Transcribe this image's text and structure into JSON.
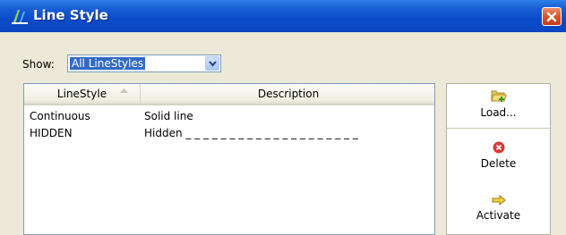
{
  "window": {
    "title": "Line Style"
  },
  "show": {
    "label": "Show:",
    "selected": "All LineStyles"
  },
  "list": {
    "columns": [
      "LineStyle",
      "Description"
    ],
    "rows": [
      {
        "name": "Continuous",
        "description": "Solid line"
      },
      {
        "name": "HIDDEN",
        "description": "Hidden _ _ _ _ _ _ _ _ _ _ _ _ _ _ _ _ _ _ _ _"
      }
    ]
  },
  "actions": {
    "load": "Load...",
    "delete": "Delete",
    "activate": "Activate"
  },
  "icons": {
    "app": "line-style-app-icon",
    "close": "close-icon",
    "dropdown": "chevron-down-icon",
    "sort": "sort-ascending-icon",
    "load": "folder-open-icon",
    "delete": "delete-icon",
    "activate": "arrow-right-icon"
  },
  "colors": {
    "title_bar": "#0a45c0",
    "selection": "#316ac5",
    "close": "#d9532b"
  }
}
